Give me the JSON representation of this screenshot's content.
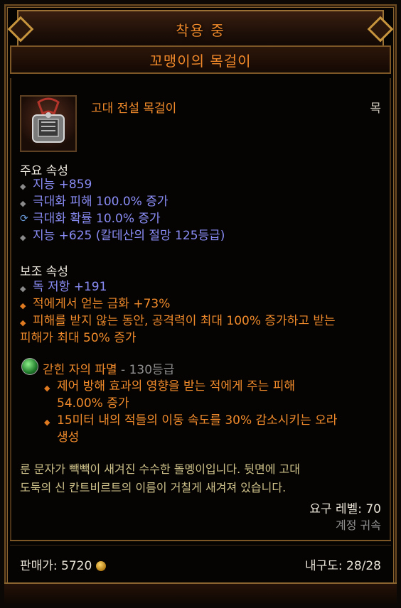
{
  "header": {
    "equipped_label": "착용 중",
    "item_name": "꼬맹이의 목걸이"
  },
  "item": {
    "icon": "amulet-icon",
    "type_label": "고대 전설 목걸이",
    "slot_label": "목"
  },
  "primary": {
    "heading": "주요 속성",
    "stats": [
      {
        "text": "지능 +859",
        "bullet": "grey-diamond"
      },
      {
        "text": "극대화 피해 100.0% 증가",
        "bullet": "grey-diamond"
      },
      {
        "text": "극대화 확률 10.0% 증가",
        "bullet": "reroll-icon"
      },
      {
        "text": "지능 +625 (칼데산의 절망 125등급)",
        "bullet": "grey-diamond"
      }
    ]
  },
  "secondary": {
    "heading": "보조 속성",
    "stats": [
      {
        "text": "독 저항 +191",
        "bullet": "grey-diamond"
      },
      {
        "text": "적에게서 얻는 금화 +73%",
        "bullet": "orange-diamond"
      },
      {
        "line1": "피해를 받지 않는 동안, 공격력이 최대 100% 증가하고 받는",
        "line2": "피해가 최대 50% 증가",
        "bullet": "orange-diamond"
      }
    ]
  },
  "gem": {
    "name": "갇힌 자의 파멸",
    "rank": " - 130등급",
    "effects": [
      {
        "line1": "제어 방해 효과의 영향을 받는 적에게 주는 피해",
        "line2": "54.00% 증가"
      },
      {
        "line1": "15미터 내의 적들의 이동 속도를 30% 감소시키는 오라",
        "line2": "생성"
      }
    ]
  },
  "flavor": {
    "line1": "룬 문자가 빽빽이 새겨진 수수한 돌멩이입니다. 뒷면에 고대",
    "line2": "도둑의 신 칸트비르트의 이름이 거칠게 새겨져 있습니다."
  },
  "requirements": {
    "level": "요구 레벨: 70",
    "bound": "계정 귀속"
  },
  "footer": {
    "sell_price": "판매가: 5720",
    "durability": "내구도: 28/28"
  },
  "colors": {
    "legendary_orange": "#f08a2a",
    "magic_blue": "#8a8cf5",
    "flavor_gold": "#cfc28a",
    "frame_gold": "#9a7236"
  }
}
